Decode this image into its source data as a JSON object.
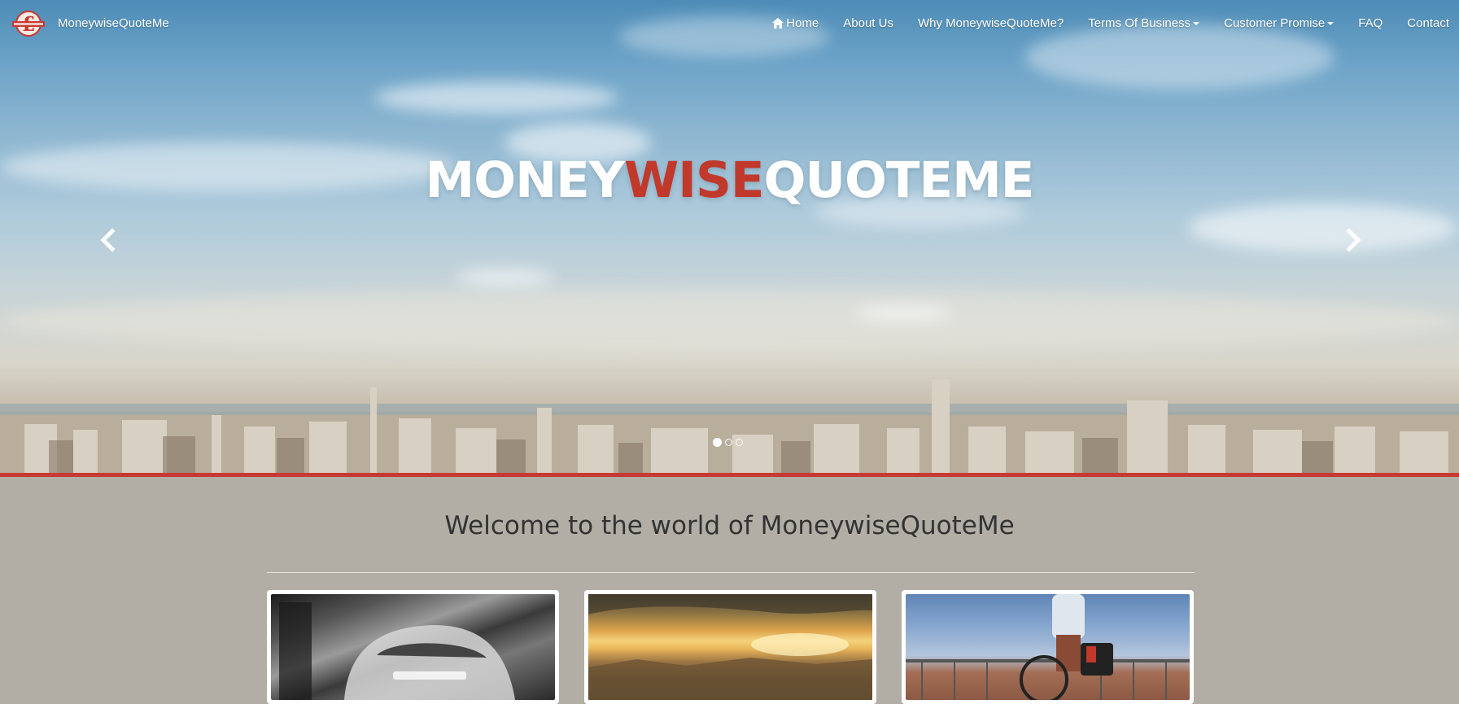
{
  "brand": {
    "name": "MoneywiseQuoteMe",
    "logo_icon": "pound-sign-logo-icon"
  },
  "nav": {
    "items": [
      {
        "label": "Home",
        "icon": "home-icon",
        "dropdown": false
      },
      {
        "label": "About Us",
        "dropdown": false
      },
      {
        "label": "Why MoneywiseQuoteMe?",
        "dropdown": false
      },
      {
        "label": "Terms Of Business",
        "dropdown": true
      },
      {
        "label": "Customer Promise",
        "dropdown": true
      },
      {
        "label": "FAQ",
        "dropdown": false
      },
      {
        "label": "Contact",
        "dropdown": false
      }
    ]
  },
  "hero": {
    "title_part1": "MONEY",
    "title_part2": "WISE",
    "title_part3": "QUOTEME",
    "accent_color": "#c0392b",
    "prev_icon": "chevron-left-icon",
    "next_icon": "chevron-right-icon",
    "slides": 3,
    "active_slide": 1
  },
  "welcome": {
    "heading": "Welcome to the world of MoneywiseQuoteMe"
  },
  "cards": [
    {
      "image": "vintage-car-photo"
    },
    {
      "image": "sunset-landscape-photo"
    },
    {
      "image": "cyclist-photo"
    }
  ],
  "colors": {
    "brand_red": "#c63a31",
    "page_background": "#b2aea6"
  }
}
